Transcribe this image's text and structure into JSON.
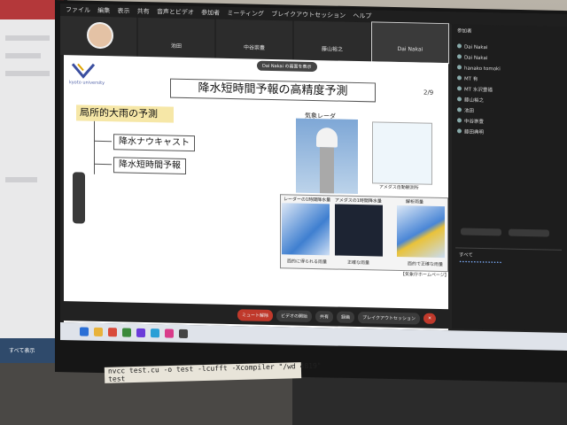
{
  "left_monitor": {
    "taskbar_button": "すべて表示"
  },
  "meeting_app": {
    "menu": [
      "ファイル",
      "編集",
      "表示",
      "共有",
      "音声とビデオ",
      "参加者",
      "ミーティング",
      "ブレイクアウトセッション",
      "ヘルプ"
    ],
    "gallery": [
      {
        "name": ""
      },
      {
        "name": "池田"
      },
      {
        "name": "中谷崇豊"
      },
      {
        "name": "藤山裕之"
      },
      {
        "name": "Dai Nakai"
      }
    ],
    "toolbar": {
      "mute": "ミュート解除",
      "video": "ビデオの開始",
      "share": "共有",
      "record": "録画",
      "breakout": "ブレイクアウトセッション"
    },
    "participants": {
      "title": "参加者",
      "rows": [
        "Dai Nakai",
        "Dai Nakai",
        "hanako tomoki",
        "MT 有",
        "MT 水沢豊福",
        "藤山裕之",
        "池田",
        "中谷崇豊",
        "藤田典明"
      ],
      "chat_name": "すべて"
    }
  },
  "slide": {
    "share_notice": "Dai Nakai の画面を表示",
    "logo_text": "kyoto university",
    "title": "降水短時間予報の高精度予測",
    "page": "2/9",
    "topic": "局所的大雨の予測",
    "items": [
      "降水ナウキャスト",
      "降水短時間予報"
    ],
    "radar_label": "気象レーダ",
    "amedas_caption": "アメダス自動観測所",
    "panels": [
      {
        "title": "レーダーの1時間降水量",
        "caption": "面的に得られる雨量"
      },
      {
        "title": "アメダスの1時間降水量",
        "caption": "正確な雨量"
      },
      {
        "title": "解析雨量",
        "caption": "面的で正確な雨量"
      }
    ],
    "source": "【気象庁ホームページ】"
  },
  "tape_label": "nvcc test.cu -o test -lcufft -Xcompiler \"/wd 4819\"\ntest",
  "colors": {
    "slide_title_box": "#ffffff",
    "topic_fill": "#f6e7a7",
    "toolbar_red": "#c0392b",
    "panel_bg": "#1d1d1d"
  }
}
